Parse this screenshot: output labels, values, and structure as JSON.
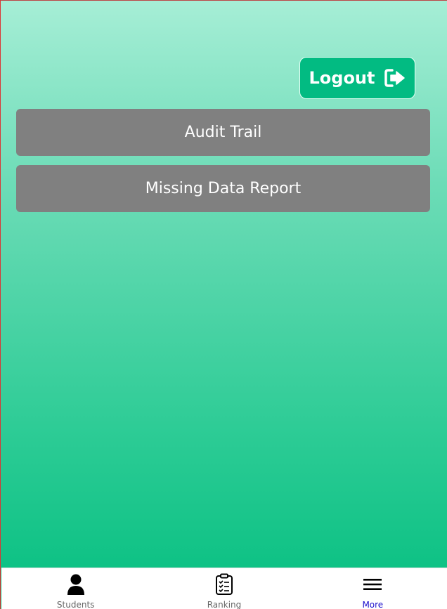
{
  "header": {
    "logout_label": "Logout"
  },
  "menu": {
    "items": [
      {
        "label": "Audit Trail"
      },
      {
        "label": "Missing Data Report"
      }
    ]
  },
  "tabbar": {
    "tabs": [
      {
        "label": "Students",
        "icon": "person-icon",
        "active": false
      },
      {
        "label": "Ranking",
        "icon": "clipboard-checklist-icon",
        "active": false
      },
      {
        "label": "More",
        "icon": "hamburger-menu-icon",
        "active": true
      }
    ],
    "active_color": "#1a0dcc"
  },
  "colors": {
    "gradient_top": "#a6eed6",
    "gradient_bottom": "#05bf80",
    "logout_button": "#02bb82",
    "menu_button": "#808080"
  }
}
